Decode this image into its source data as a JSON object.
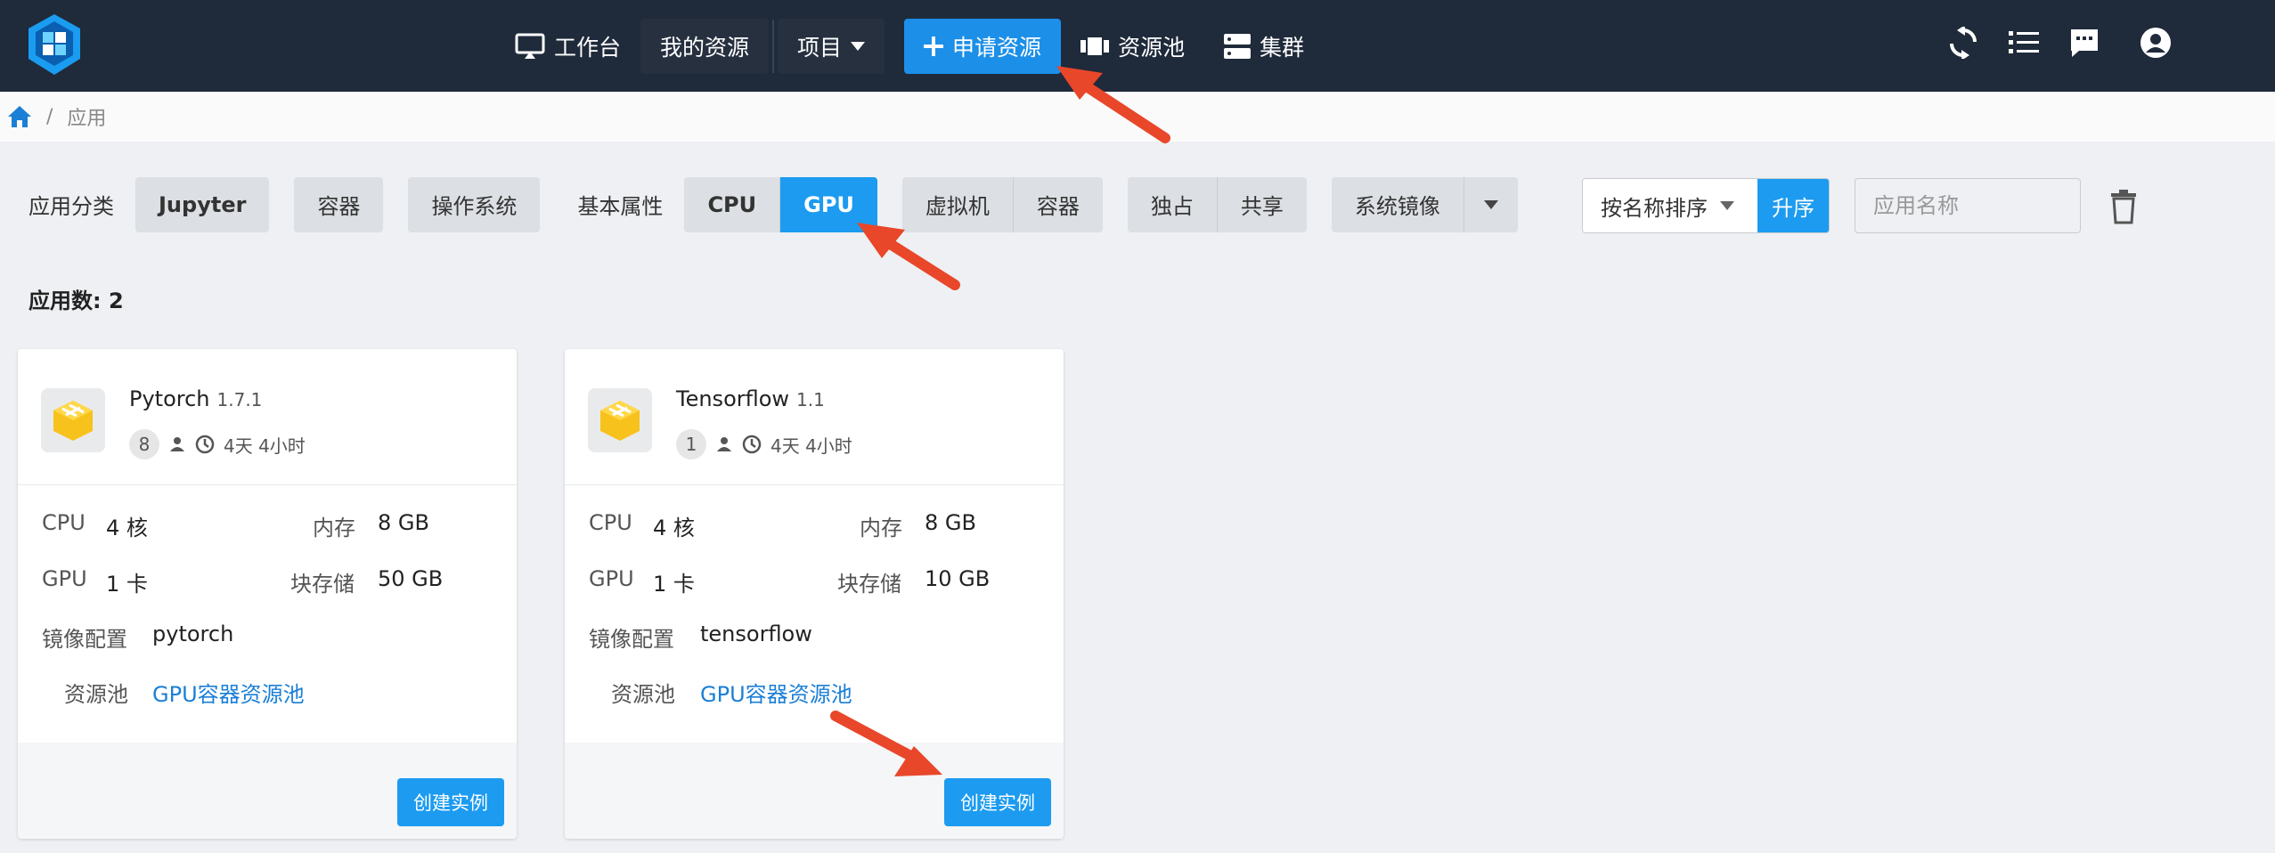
{
  "topbar": {
    "nav": {
      "workbench": "工作台",
      "my_resources": "我的资源",
      "project": "项目",
      "apply_resource": "申请资源",
      "resource_pool": "资源池",
      "cluster": "集群"
    },
    "icons": [
      "refresh-icon",
      "list-icon",
      "message-icon",
      "account-icon"
    ]
  },
  "breadcrumb": {
    "separator": "/",
    "current": "应用"
  },
  "filters": {
    "category_label": "应用分类",
    "category_options": [
      "Jupyter",
      "容器",
      "操作系统"
    ],
    "basic_label": "基本属性",
    "processor": [
      "CPU",
      "GPU"
    ],
    "processor_selected": "GPU",
    "type": [
      "虚拟机",
      "容器"
    ],
    "mode": [
      "独占",
      "共享"
    ],
    "image": "系统镜像",
    "sort_by": "按名称排序",
    "sort_order": "升序",
    "search_placeholder": "应用名称"
  },
  "app_count_label": "应用数: 2",
  "apps": [
    {
      "name": "Pytorch",
      "version": "1.7.1",
      "users": "8",
      "duration": "4天 4小时",
      "cpu_label": "CPU",
      "cpu": "4 核",
      "mem_label": "内存",
      "mem": "8 GB",
      "gpu_label": "GPU",
      "gpu": "1 卡",
      "storage_label": "块存储",
      "storage": "50 GB",
      "image_label": "镜像配置",
      "image": "pytorch",
      "pool_label": "资源池",
      "pool": "GPU容器资源池",
      "create_label": "创建实例"
    },
    {
      "name": "Tensorflow",
      "version": "1.1",
      "users": "1",
      "duration": "4天 4小时",
      "cpu_label": "CPU",
      "cpu": "4 核",
      "mem_label": "内存",
      "mem": "8 GB",
      "gpu_label": "GPU",
      "gpu": "1 卡",
      "storage_label": "块存储",
      "storage": "10 GB",
      "image_label": "镜像配置",
      "image": "tensorflow",
      "pool_label": "资源池",
      "pool": "GPU容器资源池",
      "create_label": "创建实例"
    }
  ],
  "colors": {
    "topbar": "#1f2a3a",
    "primary": "#1c9bf0",
    "link": "#1b7fd6",
    "annotation_arrow": "#e8472a"
  }
}
